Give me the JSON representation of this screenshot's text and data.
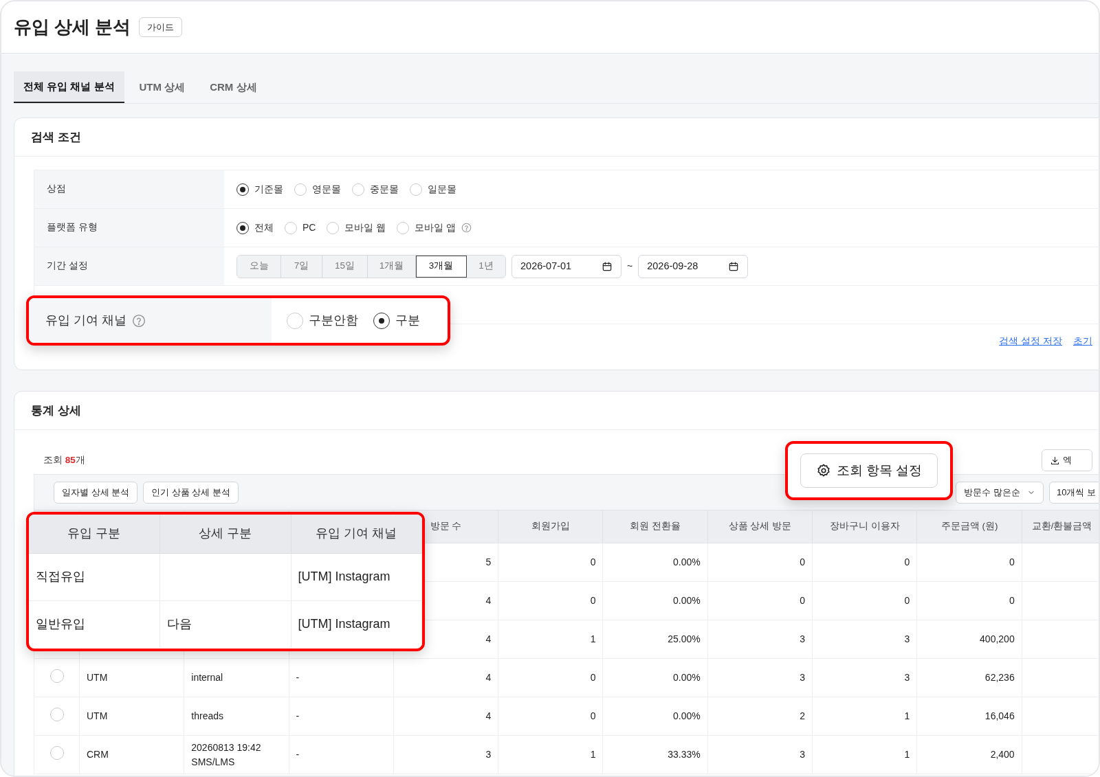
{
  "page": {
    "title": "유입 상세 분석",
    "guide_button": "가이드"
  },
  "tabs": [
    {
      "label": "전체 유입 채널 분석",
      "selected": true
    },
    {
      "label": "UTM 상세",
      "selected": false
    },
    {
      "label": "CRM 상세",
      "selected": false
    }
  ],
  "search": {
    "title": "검색 조건",
    "rows": [
      {
        "label": "상점",
        "kind": "radios",
        "options": [
          {
            "label": "기준몰",
            "selected": true
          },
          {
            "label": "영문몰",
            "selected": false
          },
          {
            "label": "중문몰",
            "selected": false
          },
          {
            "label": "일문몰",
            "selected": false
          }
        ]
      },
      {
        "label": "플랫폼 유형",
        "kind": "radios",
        "options": [
          {
            "label": "전체",
            "selected": true
          },
          {
            "label": "PC",
            "selected": false
          },
          {
            "label": "모바일 웹",
            "selected": false
          },
          {
            "label": "모바일 앱",
            "selected": false,
            "help": true
          }
        ]
      },
      {
        "label": "기간 설정",
        "kind": "period",
        "presets": [
          {
            "label": "오늘",
            "selected": false
          },
          {
            "label": "7일",
            "selected": false
          },
          {
            "label": "15일",
            "selected": false
          },
          {
            "label": "1개월",
            "selected": false
          },
          {
            "label": "3개월",
            "selected": true
          },
          {
            "label": "1년",
            "selected": false
          }
        ],
        "start": "2026-07-01",
        "separator": "~",
        "end": "2026-09-28"
      }
    ],
    "links": [
      "검색 설정 저장",
      "초기"
    ]
  },
  "stats": {
    "title": "통계 상세",
    "count_prefix": "조회",
    "count": "85",
    "count_suffix": "개",
    "excel_button": "엑",
    "tool_buttons": [
      "일자별 상세 분석",
      "인기 상품 상세 분석"
    ],
    "sort": "방문수 많은순",
    "page_size": "10개씩 보",
    "table": {
      "columns": [
        "방문 수",
        "회원가입",
        "회원 전환율",
        "상품 상세 방문",
        "장바구니 이용자",
        "주문금액 (원)",
        "교환/환불금액"
      ],
      "rows": [
        {
          "values": [
            "5",
            "0",
            "0.00%",
            "0",
            "0",
            "0"
          ]
        },
        {
          "values": [
            "4",
            "0",
            "0.00%",
            "0",
            "0",
            "0"
          ]
        },
        {
          "values": [
            "4",
            "1",
            "25.00%",
            "3",
            "3",
            "400,200"
          ]
        },
        {
          "selected": false,
          "type": "UTM",
          "detail": "internal",
          "channel": "-",
          "values": [
            "4",
            "0",
            "0.00%",
            "3",
            "3",
            "62,236"
          ]
        },
        {
          "selected": false,
          "type": "UTM",
          "detail": "threads",
          "channel": "-",
          "values": [
            "4",
            "0",
            "0.00%",
            "2",
            "1",
            "16,046"
          ]
        },
        {
          "selected": false,
          "type": "CRM",
          "detail": "20260813 19:42\nSMS/LMS",
          "channel": "-",
          "values": [
            "3",
            "1",
            "33.33%",
            "3",
            "1",
            "2,400"
          ]
        }
      ]
    }
  },
  "callouts": [
    {
      "kind": "filter",
      "label": "유입 기여 채널",
      "help": true,
      "options": [
        {
          "label": "구분안함",
          "selected": false
        },
        {
          "label": "구분",
          "selected": true
        }
      ]
    },
    {
      "kind": "button",
      "label": "조회 항목 설정"
    },
    {
      "kind": "table",
      "columns": [
        "유입 구분",
        "상세 구분",
        "유입 기여 채널"
      ],
      "rows": [
        [
          "직접유입",
          null,
          "[UTM] Instagram"
        ],
        [
          "일반유입",
          "다음",
          "[UTM] Instagram"
        ]
      ]
    }
  ]
}
